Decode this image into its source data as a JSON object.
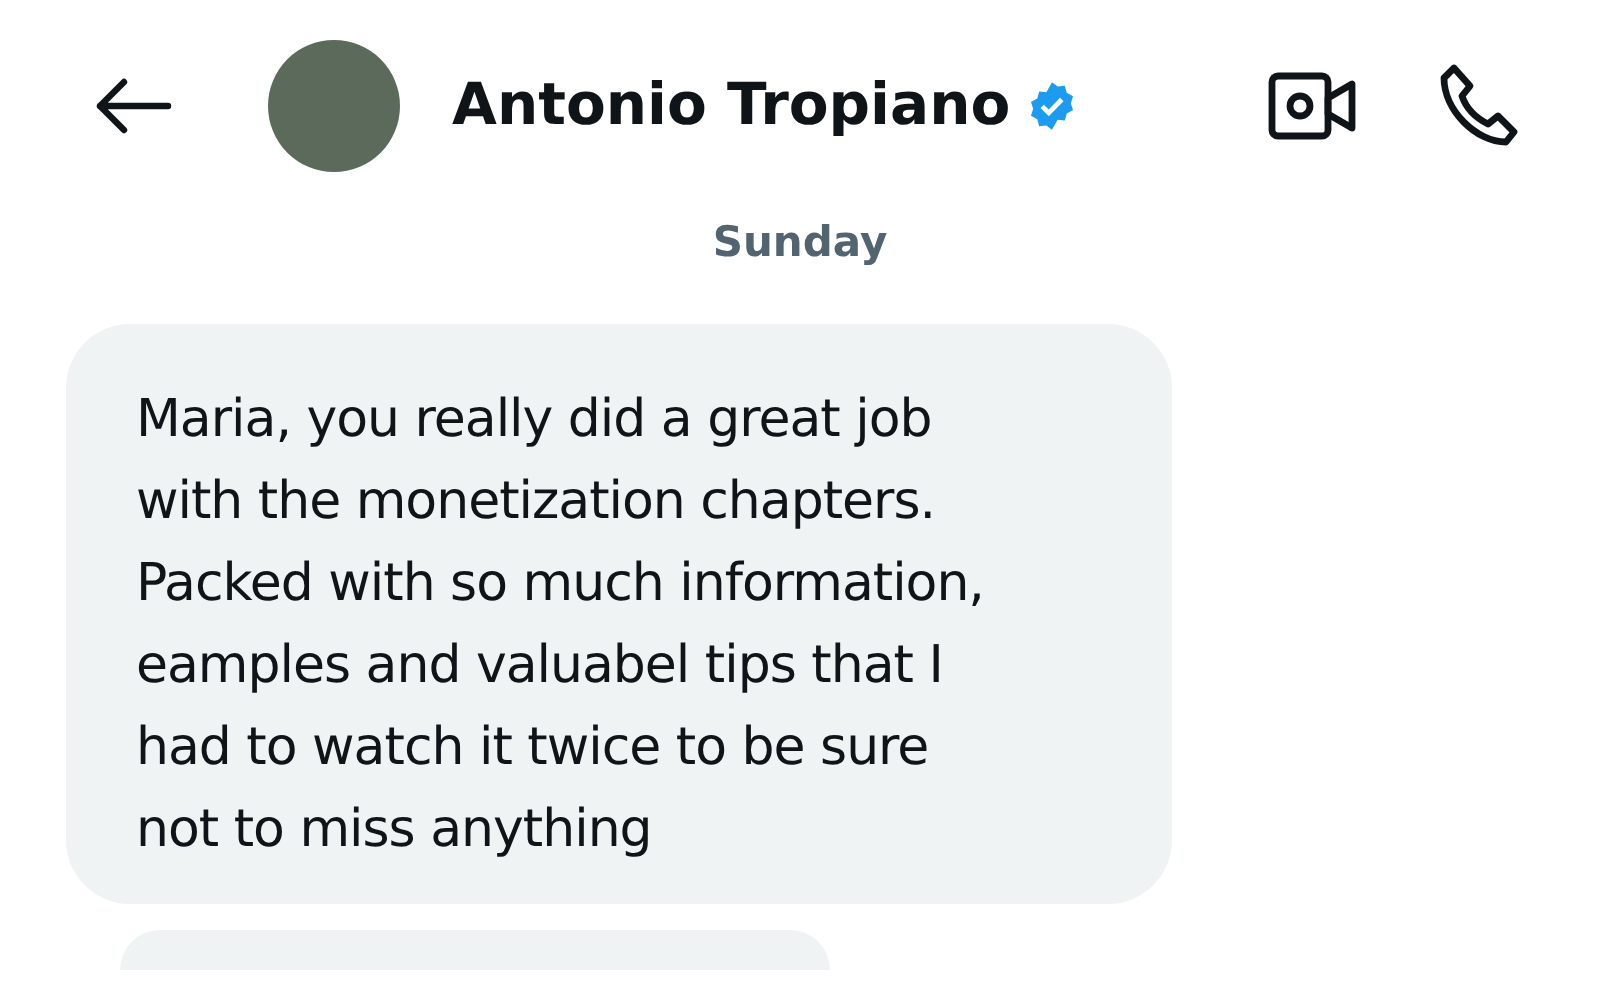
{
  "header": {
    "name": "Antonio Tropiano",
    "verified": true
  },
  "day_label": "Sunday",
  "messages": [
    {
      "text": "Maria, you really did a great job\nwith the monetization chapters.\nPacked with so much information,\neamples and valuabel tips that I\nhad to watch it twice to be sure\nnot to miss anything"
    }
  ]
}
